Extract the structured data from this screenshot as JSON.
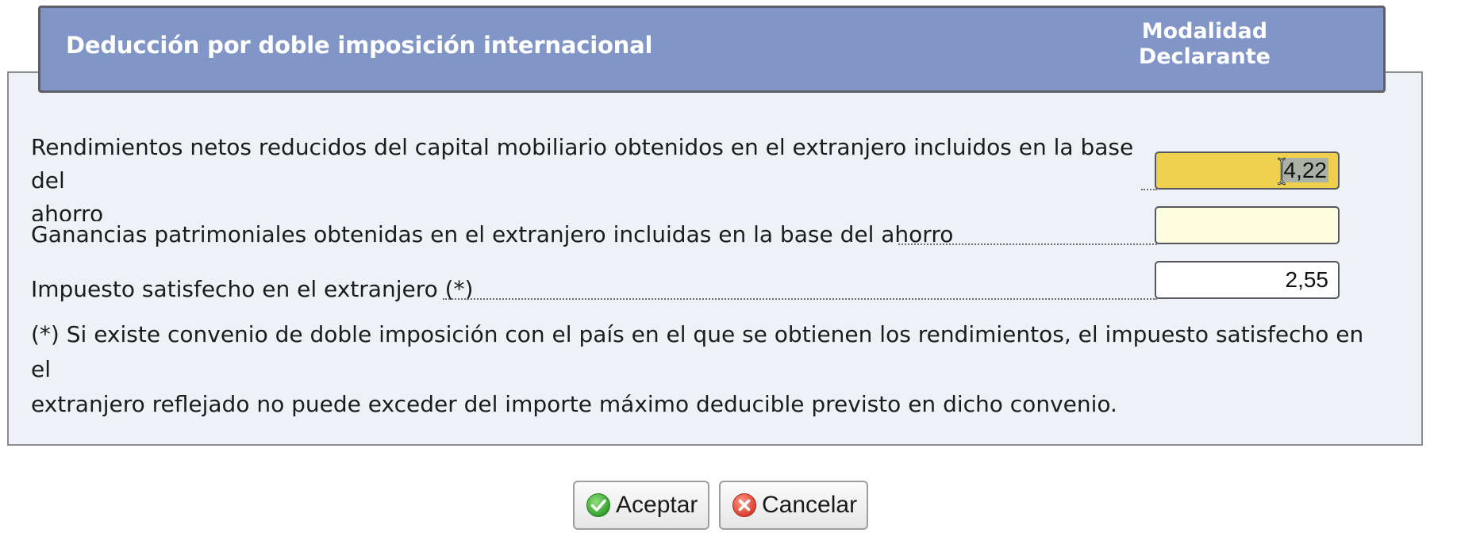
{
  "header": {
    "title": "Deducción por doble imposición internacional",
    "modality_line1": "Modalidad",
    "modality_line2": "Declarante"
  },
  "rows": [
    {
      "label_line1": "Rendimientos netos reducidos del capital mobiliario obtenidos en el extranjero incluidos en la base del",
      "label_line2": "ahorro",
      "value": "4,22",
      "state": "active-selected"
    },
    {
      "label": "Ganancias patrimoniales obtenidas en el extranjero incluidas en la base del ahorro",
      "value": "",
      "state": "empty"
    },
    {
      "label": "Impuesto satisfecho en el extranjero (*)",
      "value": "2,55",
      "state": "filled"
    }
  ],
  "note": {
    "line1": "(*) Si existe convenio de doble imposición con el país en el que se obtienen los rendimientos, el impuesto satisfecho en el",
    "line2": "extranjero reflejado no puede exceder del importe máximo deducible previsto en dicho convenio."
  },
  "buttons": {
    "accept_label": "Aceptar",
    "accept_icon": "check-circle-icon",
    "cancel_label": "Cancelar",
    "cancel_icon": "close-circle-icon"
  },
  "colors": {
    "header_bg": "#8196c7",
    "panel_bg": "#eef1f6",
    "active_field_bg": "#eed04e",
    "empty_field_bg": "#fffde0",
    "accept_icon": "#3fae3a",
    "cancel_icon": "#e0483a"
  }
}
